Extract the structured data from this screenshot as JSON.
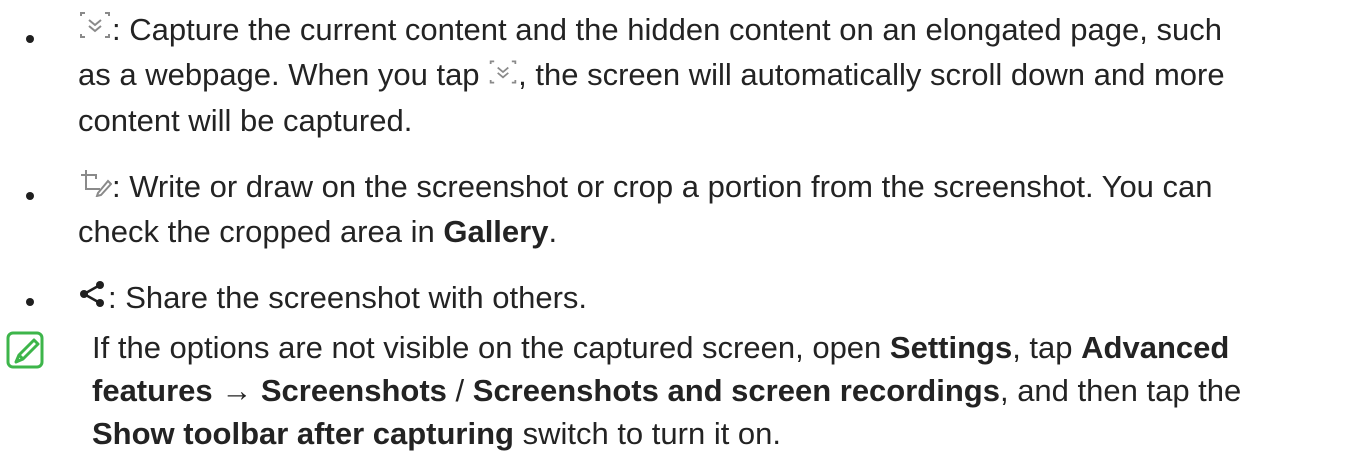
{
  "items": [
    {
      "icon": "scroll-capture-icon",
      "lines": [
        [
          ": Capture the current content and the hidden content on an elongated page, such"
        ],
        [
          "as a webpage. When you tap ",
          "{icon}",
          ", the screen will automatically scroll down and more"
        ],
        [
          "content will be captured."
        ]
      ],
      "line1": ": Capture the current content and the hidden content on an elongated page, such",
      "line2a": "as a webpage. When you tap ",
      "line2b": ", the screen will automatically scroll down and more",
      "line3": "content will be captured."
    },
    {
      "icon": "crop-draw-icon",
      "line1": ": Write or draw on the screenshot or crop a portion from the screenshot. You can",
      "line2a": "check the cropped area in ",
      "line2_bold": "Gallery",
      "line2b": "."
    },
    {
      "icon": "share-icon",
      "line1": ": Share the screenshot with others."
    }
  ],
  "note": {
    "icon": "note-icon",
    "line1a": "If the options are not visible on the captured screen, open ",
    "line1_bold1": "Settings",
    "line1b": ", tap ",
    "line1_bold2": "Advanced",
    "line2_bold1": "features",
    "line2a": " → ",
    "line2_bold2": "Screenshots",
    "line2b": " / ",
    "line2_bold3": "Screenshots and screen recordings",
    "line2c": ", and then tap the",
    "line3_bold": "Show toolbar after capturing",
    "line3a": " switch to turn it on."
  },
  "colors": {
    "text": "#232323",
    "note_icon": "#3db54a"
  }
}
